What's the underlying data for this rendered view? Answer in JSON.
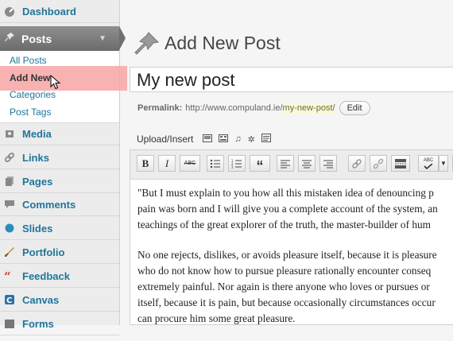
{
  "sidebar": {
    "dashboard": "Dashboard",
    "posts": "Posts",
    "submenu": [
      "All Posts",
      "Add New",
      "Categories",
      "Post Tags"
    ],
    "items": [
      "Media",
      "Links",
      "Pages",
      "Comments",
      "Slides",
      "Portfolio",
      "Feedback",
      "Canvas",
      "Forms"
    ]
  },
  "header": {
    "title": "Add New Post"
  },
  "editor": {
    "title_value": "My new post",
    "permalink_label": "Permalink:",
    "permalink_base": "http://www.compuland.ie/",
    "permalink_slug": "my-new-post",
    "permalink_end": "/",
    "edit_label": "Edit",
    "upload_label": "Upload/Insert",
    "toolbar": {
      "bold": "B",
      "italic": "I",
      "strike": "ABC",
      "quote": "“",
      "spell": "ABC"
    },
    "paragraphs": [
      [
        "\"But I must explain to you how all this mistaken idea of denouncing p",
        "pain was born and I will give you a complete account of the system, an",
        "teachings of the great explorer of the truth, the master-builder of hum"
      ],
      [
        "No one rejects, dislikes, or avoids pleasure itself, because it is pleasure",
        "who do not know how to pursue pleasure rationally encounter conseq",
        "extremely painful. Nor again is there anyone who loves or pursues or",
        "itself, because it is pain, but because occasionally circumstances occur",
        "can procure him some great pleasure."
      ]
    ]
  },
  "colors": {
    "link": "#21759b",
    "highlight": "#f7a4a4",
    "posts_menu": "#7a7a7a"
  }
}
